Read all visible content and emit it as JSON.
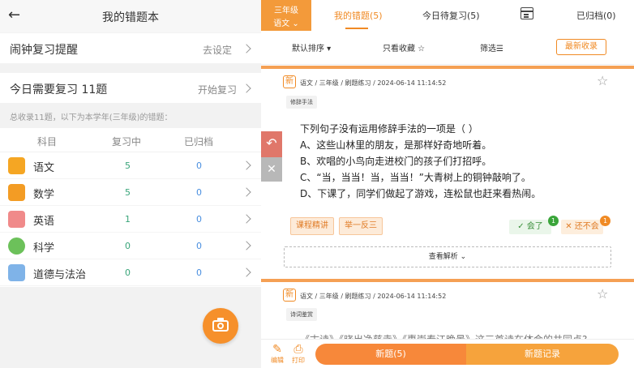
{
  "left": {
    "header": {
      "back_icon": "back-arrow-icon",
      "title": "我的错题本"
    },
    "alarm": {
      "label": "闹钟复习提醒",
      "action": "去设定"
    },
    "today": {
      "label": "今日需要复习  11题",
      "action": "开始复习"
    },
    "note": "总收录11题，以下为本学年(三年级)的错题：",
    "table": {
      "headers": [
        "科目",
        "复习中",
        "已归档"
      ],
      "rows": [
        {
          "subject": "语文",
          "reviewing": "5",
          "archived": "0",
          "icon": "chinese-book-icon",
          "color": "#f5a623"
        },
        {
          "subject": "数学",
          "reviewing": "5",
          "archived": "0",
          "icon": "math-icon",
          "color": "#f39c24"
        },
        {
          "subject": "英语",
          "reviewing": "1",
          "archived": "0",
          "icon": "english-abc-icon",
          "color": "#f08a8a"
        },
        {
          "subject": "科学",
          "reviewing": "0",
          "archived": "0",
          "icon": "science-bulb-icon",
          "color": "#6cc15a"
        },
        {
          "subject": "道德与法治",
          "reviewing": "0",
          "archived": "0",
          "icon": "morality-icon",
          "color": "#7fb3e8"
        }
      ]
    },
    "camera_icon": "camera-icon"
  },
  "right": {
    "grade": {
      "line1": "三年级",
      "line2": "语文 ⌄"
    },
    "tabs": [
      {
        "label": "我的错题(5)",
        "active": true
      },
      {
        "label": "今日待复习(5)",
        "active": false
      },
      {
        "label": "已归档(0)",
        "active": false
      }
    ],
    "filters": {
      "sort": "默认排序 ▾",
      "favorites": "只看收藏 ☆",
      "filter": "筛选☰",
      "latest": "最新收录"
    },
    "question1": {
      "new_tag": "新",
      "meta": "语文 / 三年级 / 刷题练习 / 2024-06-14 11:14:52",
      "knowledge_tag": "修辞手法",
      "stem": "下列句子没有运用修辞手法的一项是（     ）",
      "options": [
        "A、这些山林里的朋友，是那样好奇地听着。",
        "B、欢唱的小鸟向走进校门的孩子们打招呼。",
        "C、“当，当当！当，当当！”大青树上的铜钟敲响了。",
        "D、下课了，同学们做起了游戏，连松鼠也赶来看热闹。"
      ],
      "chips": [
        "课程精讲",
        "举一反三"
      ],
      "know_label": "✓ 会了",
      "know_count": "1",
      "dont_label": "✕ 还不会",
      "dont_count": "1",
      "analysis": "查看解析 ⌄"
    },
    "question2": {
      "new_tag": "新",
      "meta": "语文 / 三年级 / 刷题练习 / 2024-06-14 11:14:52",
      "knowledge_tag": "诗词鉴赏",
      "stem_partial": "《古诗》《晓出净慈寺》《惠崇春江晚景》这三首诗在体会的共同点?"
    },
    "side": {
      "undo": "↶",
      "close": "✕"
    },
    "bottom": {
      "edit_label": "编辑",
      "print_label": "打印",
      "new_button": "新题(5)",
      "record_button": "新题记录"
    },
    "colors": {
      "accent": "#f08a24",
      "divider": "#f5a054"
    }
  }
}
